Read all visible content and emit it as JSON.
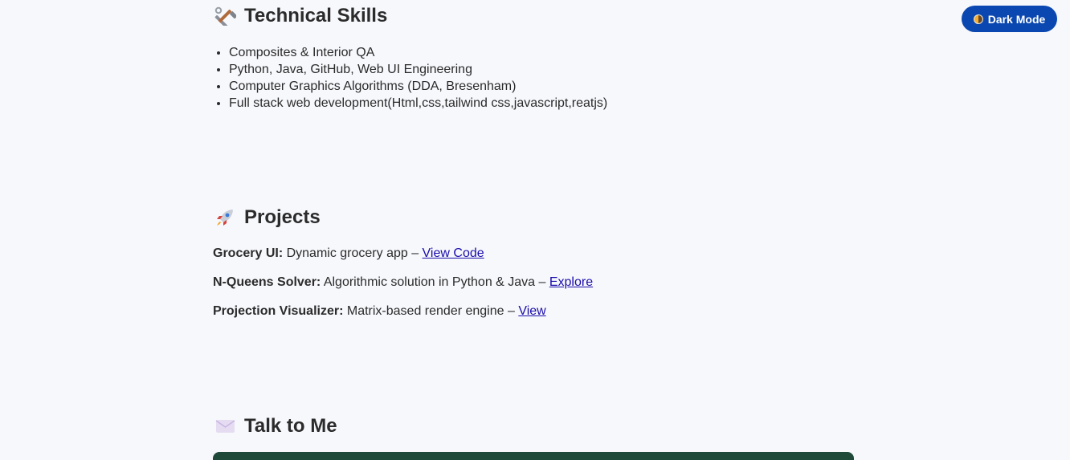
{
  "header": {
    "dark_mode_label": "Dark Mode"
  },
  "skills": {
    "title": "Technical Skills",
    "icon": "hammer-and-wrench-icon",
    "items": [
      "Composites & Interior QA",
      "Python, Java, GitHub, Web UI Engineering",
      "Computer Graphics Algorithms (DDA, Bresenham)",
      "Full stack web development(Html,css,tailwind css,javascript,reatjs)"
    ]
  },
  "projects": {
    "title": "Projects",
    "icon": "rocket-icon",
    "items": [
      {
        "name": "Grocery UI:",
        "description": " Dynamic grocery app – ",
        "link": "View Code"
      },
      {
        "name": "N-Queens Solver:",
        "description": " Algorithmic solution in Python & Java – ",
        "link": "Explore"
      },
      {
        "name": "Projection Visualizer:",
        "description": " Matrix-based render engine – ",
        "link": "View"
      }
    ]
  },
  "contact": {
    "title": "Talk to Me",
    "icon": "envelope-icon"
  },
  "colors": {
    "background": "#f7f8fc",
    "button": "#0a47b0",
    "link": "#1a0dab",
    "form_accent": "#1f4a3a"
  }
}
